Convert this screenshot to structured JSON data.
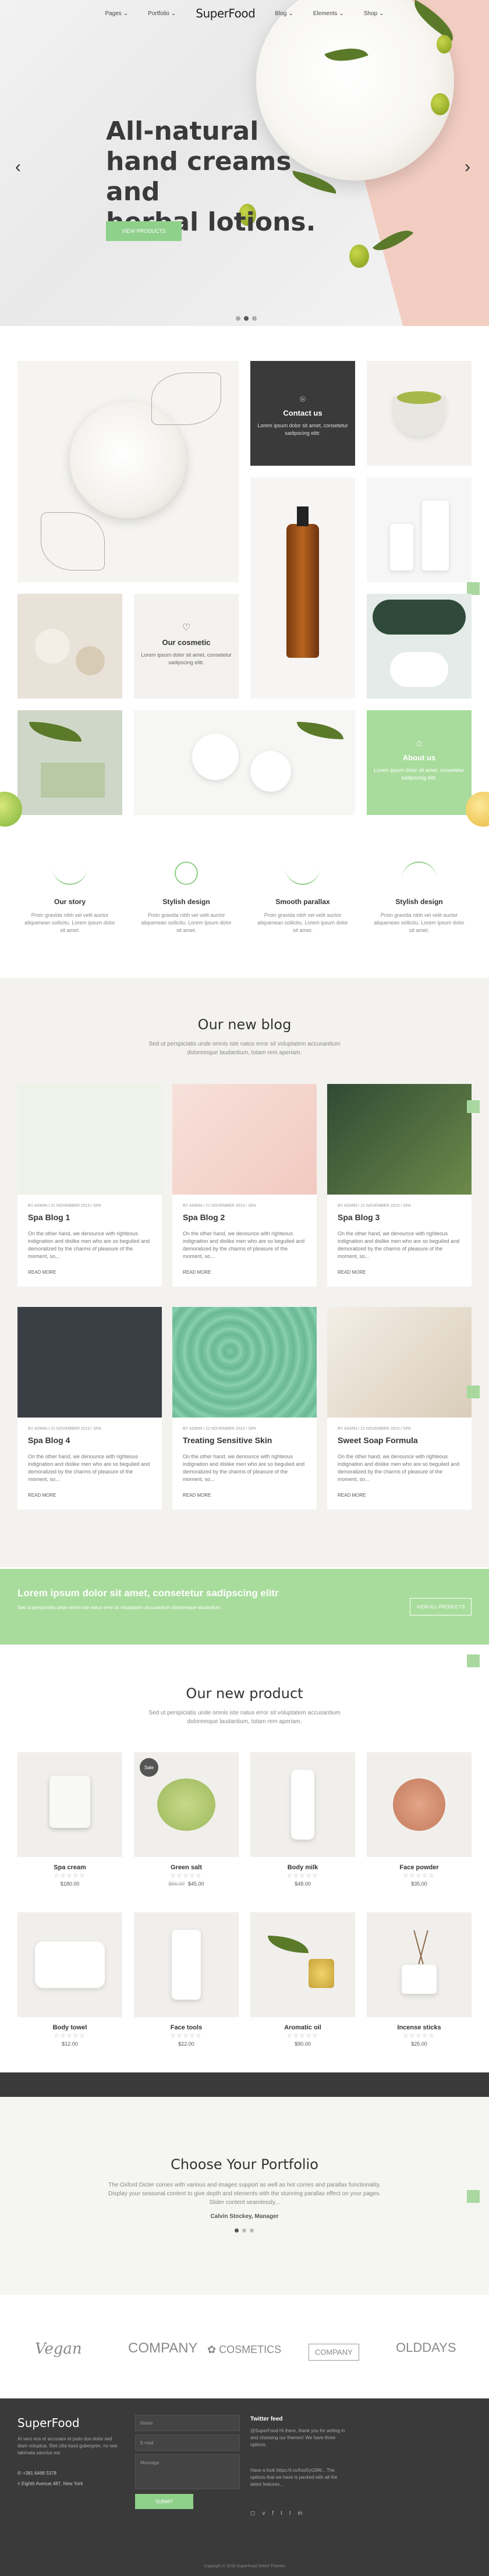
{
  "header": {
    "logo": "SuperFood",
    "nav": [
      {
        "label": "Pages"
      },
      {
        "label": "Portfolio"
      },
      {
        "label": "Blog"
      },
      {
        "label": "Elements"
      },
      {
        "label": "Shop"
      }
    ]
  },
  "hero": {
    "title_lines": [
      "All-natural",
      "hand creams and",
      "herbal lotions."
    ],
    "button": "VIEW PRODUCTS",
    "slides": 3,
    "active_slide": 2
  },
  "tiles": {
    "contact": {
      "title": "Contact us",
      "text": "Lorem ipsum dolor sit amet, consetetur sadipscing elitr."
    },
    "story": {
      "title": "Our cosmetic",
      "text": "Lorem ipsum dolor sit amet, consetetur sadipscing elitr."
    },
    "about": {
      "title": "About us",
      "text": "Lorem ipsum dolor sit amet, consetetur sadipscing elitr."
    }
  },
  "features": [
    {
      "title": "Our story",
      "text": "Proin gravida nibh vel velit auctor aliquenean sollicitu. Lorem ipsum dolor sit amet."
    },
    {
      "title": "Stylish design",
      "text": "Proin gravida nibh vel velit auctor aliquenean sollicitu. Lorem ipsum dolor sit amet."
    },
    {
      "title": "Smooth parallax",
      "text": "Proin gravida nibh vel velit auctor aliquenean sollicitu. Lorem ipsum dolor sit amet."
    },
    {
      "title": "Stylish design",
      "text": "Proin gravida nibh vel velit auctor aliquenean sollicitu. Lorem ipsum dolor sit amet."
    }
  ],
  "blog": {
    "title": "Our new blog",
    "subtitle_1": "Sed ut perspiciatis unde omnis iste natus error sit voluptatem accusantium",
    "subtitle_2": "doloremque laudantium, totam rem aperiam.",
    "posts": [
      {
        "meta": "BY ADMIN / 21 NOVEMBER 2015 / SPA",
        "title": "Spa Blog 1",
        "text": "On the other hand, we denounce with righteous indignation and dislike men who are so beguiled and demoralized by the charms of pleasure of the moment, so...",
        "more": "READ MORE"
      },
      {
        "meta": "BY ADMIN / 21 NOVEMBER 2015 / SPA",
        "title": "Spa Blog 2",
        "text": "On the other hand, we denounce with righteous indignation and dislike men who are so beguiled and demoralized by the charms of pleasure of the moment, so...",
        "more": "READ MORE"
      },
      {
        "meta": "BY ADMIN / 21 NOVEMBER 2015 / SPA",
        "title": "Spa Blog 3",
        "text": "On the other hand, we denounce with righteous indignation and dislike men who are so beguiled and demoralized by the charms of pleasure of the moment, so...",
        "more": "READ MORE"
      },
      {
        "meta": "BY ADMIN / 21 NOVEMBER 2015 / SPA",
        "title": "Spa Blog 4",
        "text": "On the other hand, we denounce with righteous indignation and dislike men who are so beguiled and demoralized by the charms of pleasure of the moment, so...",
        "more": "READ MORE"
      },
      {
        "meta": "BY ADMIN / 21 NOVEMBER 2015 / SPA",
        "title": "Treating Sensitive Skin",
        "text": "On the other hand, we denounce with righteous indignation and dislike men who are so beguiled and demoralized by the charms of pleasure of the moment, so...",
        "more": "READ MORE"
      },
      {
        "meta": "BY ADMIN / 21 NOVEMBER 2015 / SPA",
        "title": "Sweet Soap Formula",
        "text": "On the other hand, we denounce with righteous indignation and dislike men who are so beguiled and demoralized by the charms of pleasure of the moment, so...",
        "more": "READ MORE"
      }
    ]
  },
  "banner": {
    "title": "Lorem ipsum dolor sit amet, consetetur sadipscing elitr",
    "text": "Sed ut perspiciatis unde omnis iste natus error sit voluptatem accusantium doloremque laudantium.",
    "button": "VIEW ALL PRODUCTS"
  },
  "products": {
    "title": "Our new product",
    "subtitle_1": "Sed ut perspiciatis unde omnis iste natus error sit voluptatem accusantium",
    "subtitle_2": "doloremque laudantium, totam rem aperiam.",
    "sale_badge": "Sale",
    "items": [
      {
        "name": "Spa cream",
        "stars": "☆☆☆☆☆",
        "price": "$180.00",
        "old_price": ""
      },
      {
        "name": "Green salt",
        "stars": "☆☆☆☆☆",
        "price": "$45.00",
        "old_price": "$56.00"
      },
      {
        "name": "Body milk",
        "stars": "☆☆☆☆☆",
        "price": "$48.00",
        "old_price": ""
      },
      {
        "name": "Face powder",
        "stars": "☆☆☆☆☆",
        "price": "$35.00",
        "old_price": ""
      },
      {
        "name": "Body towel",
        "stars": "☆☆☆☆☆",
        "price": "$12.00",
        "old_price": ""
      },
      {
        "name": "Face tools",
        "stars": "☆☆☆☆☆",
        "price": "$22.00",
        "old_price": ""
      },
      {
        "name": "Aromatic oil",
        "stars": "☆☆☆☆☆",
        "price": "$90.00",
        "old_price": ""
      },
      {
        "name": "Incense sticks",
        "stars": "☆☆☆☆☆",
        "price": "$25.00",
        "old_price": ""
      }
    ]
  },
  "portfolio": {
    "title": "Choose Your Portfolio",
    "text_1": "The Oxford Dicter comes with various and images support as well as hot comes and parallax functionality.",
    "text_2": "Display your seasonal content to give depth and elements with the stunning parallax effect on your pages.",
    "text_3": "Slider content seamlessly...",
    "author": "Calvin Stockey, Manager",
    "slides": 3,
    "active_slide": 1
  },
  "brands": [
    "Vegan",
    "COMPANY",
    "COSMETICS",
    "COMPANY",
    "OLDDAYS"
  ],
  "footer": {
    "logo": "SuperFood",
    "about": "At vero eos et accusam et justo duo dolor sed diam voluptua. Stet clita kasd gubergren, no sea takimata sanctus est.",
    "phone": "+381 6468 5378",
    "address": "Eighth Avenue 487, New York",
    "form": {
      "name": "Name",
      "email": "E-mail",
      "message": "Message",
      "submit": "SUBMIT"
    },
    "twitter_title": "Twitter feed",
    "tweets": [
      "@SuperFood Hi there, thank you for writing in and choosing our themes! We have three options.",
      "Have a look https://t.co/hxs5yG9W... The options that we have is packed with all the latest features..."
    ],
    "copyright": "Copyright © 2016 SuperFood Select Themes"
  }
}
